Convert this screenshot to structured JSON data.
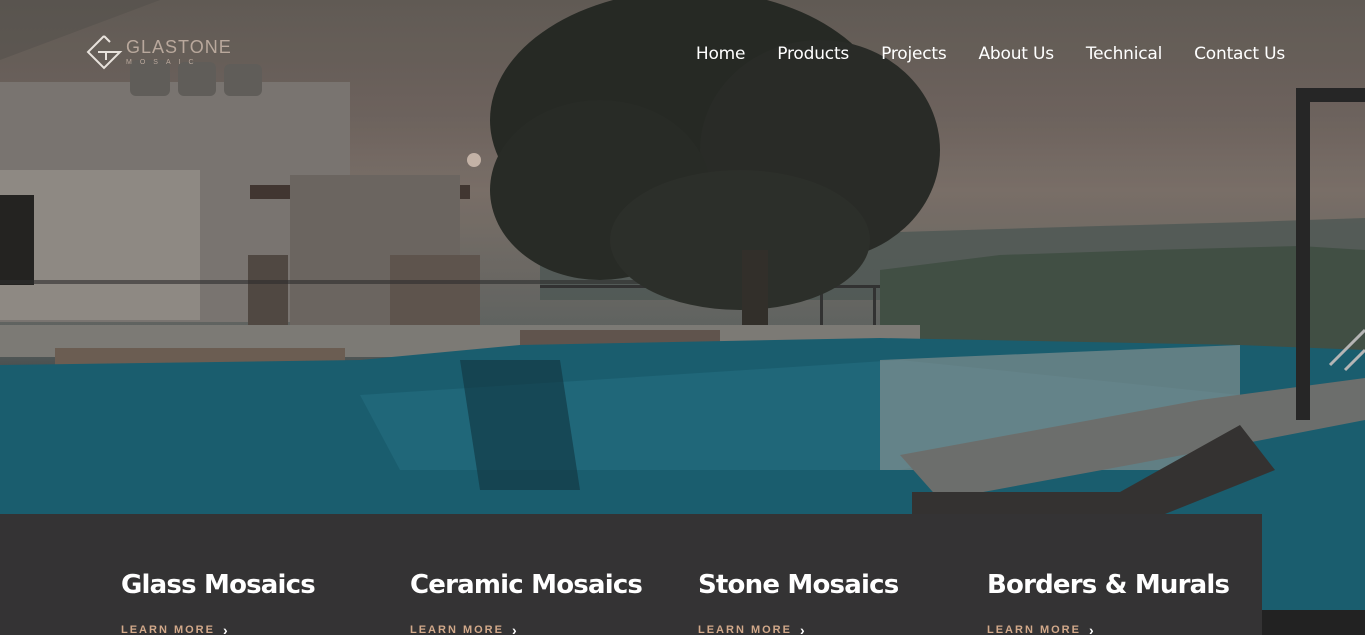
{
  "brand": {
    "name": "GLASTONE",
    "sub": "MOSAIC"
  },
  "nav": {
    "items": [
      {
        "label": "Home"
      },
      {
        "label": "Products"
      },
      {
        "label": "Projects"
      },
      {
        "label": "About Us"
      },
      {
        "label": "Technical"
      },
      {
        "label": "Contact Us"
      }
    ]
  },
  "hero": {
    "image": "resort-infinity-pool-sunset"
  },
  "categories": [
    {
      "title": "Glass Mosaics",
      "link": "LEARN MORE"
    },
    {
      "title": "Ceramic Mosaics",
      "link": "LEARN MORE"
    },
    {
      "title": "Stone Mosaics",
      "link": "LEARN MORE"
    },
    {
      "title": "Borders & Murals",
      "link": "LEARN MORE"
    }
  ],
  "colors": {
    "strip": "#343334",
    "link": "#d2a98a",
    "brand": "#b9a89c"
  }
}
